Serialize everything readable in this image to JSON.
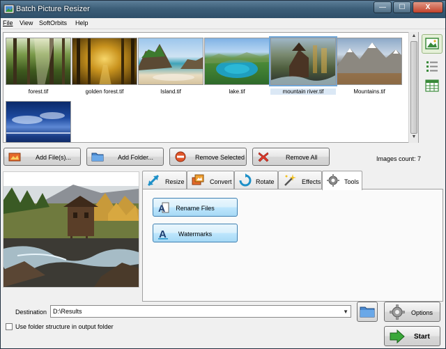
{
  "window": {
    "title": "Batch Picture Resizer"
  },
  "titlebar": {
    "min_label": "—",
    "max_label": "☐",
    "close_label": "X"
  },
  "menu": {
    "items": [
      "File",
      "View",
      "SoftOrbits",
      "Help"
    ]
  },
  "gallery": {
    "items": [
      {
        "name": "forest.tif",
        "selected": false
      },
      {
        "name": "golden forest.tif",
        "selected": false
      },
      {
        "name": "Island.tif",
        "selected": false
      },
      {
        "name": "lake.tif",
        "selected": false
      },
      {
        "name": "mountain river.tif",
        "selected": true
      },
      {
        "name": "Mountains.tif",
        "selected": false
      },
      {
        "name": "",
        "selected": false
      }
    ]
  },
  "actions": {
    "add_files": "Add File(s)...",
    "add_folder": "Add Folder...",
    "remove_selected": "Remove Selected",
    "remove_all": "Remove All"
  },
  "status": {
    "images_count": "Images count: 7"
  },
  "tabs": {
    "items": [
      "Resize",
      "Convert",
      "Rotate",
      "Effects",
      "Tools"
    ],
    "active": "Tools"
  },
  "tools": {
    "rename_files": "Rename Files",
    "watermarks": "Watermarks"
  },
  "destination": {
    "label": "Destination",
    "value": "D:\\Results",
    "use_folder_structure_label": "Use folder structure in output folder",
    "use_folder_structure_checked": false
  },
  "buttons": {
    "options": "Options",
    "start": "Start"
  },
  "icons": {
    "app": "app-icon",
    "scroll_up": "▲",
    "scroll_down": "▼",
    "dropdown": "▼"
  },
  "colors": {
    "accent": "#3c7fb1",
    "titlebar": "#3d5f79",
    "selection": "#6ea6d8"
  }
}
